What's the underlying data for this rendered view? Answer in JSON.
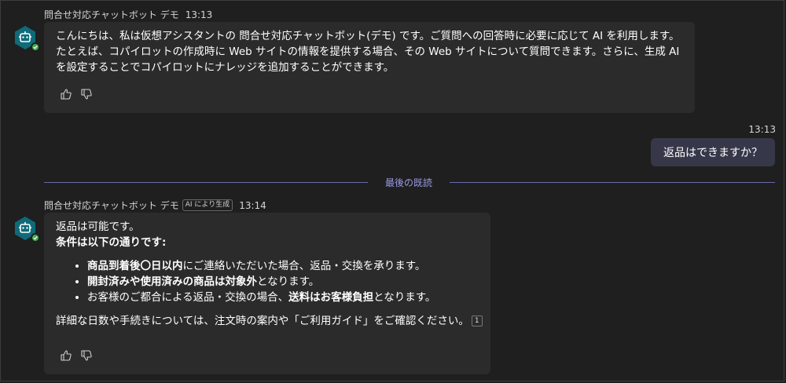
{
  "bot": {
    "name": "問合せ対応チャットボット デモ"
  },
  "msg1": {
    "time": "13:13",
    "text": "こんにちは、私は仮想アシスタントの 問合せ対応チャットボット(デモ) です。ご質問への回答時に必要に応じて AI を利用します。 たとえば、コパイロットの作成時に Web サイトの情報を提供する場合、その Web サイトについて質問できます。さらに、生成 AI を設定することでコパイロットにナレッジを追加することができます。"
  },
  "user_msg": {
    "time": "13:13",
    "text": "返品はできますか？"
  },
  "divider": {
    "label": "最後の既読"
  },
  "msg2": {
    "ai_badge": "AI により生成",
    "time": "13:14",
    "line1": "返品は可能です。",
    "line2": "条件は以下の通りです:",
    "bullets": [
      {
        "bold": "商品到着後〇日以内",
        "rest": "にご連絡いただいた場合、返品・交換を承ります。"
      },
      {
        "bold": "開封済みや使用済みの商品は対象外",
        "rest": "となります。"
      },
      {
        "pre": "お客様のご都合による返品・交換の場合、",
        "bold": "送料はお客様負担",
        "rest": "となります。"
      }
    ],
    "footer": "詳細な日数や手続きについては、注文時の案内や「ご利用ガイド」をご確認ください。",
    "citation": "1"
  },
  "icons": {
    "avatar": "bot-hexagon-icon",
    "like": "thumbs-up-icon",
    "dislike": "thumbs-down-icon",
    "status": "available-check-icon"
  },
  "colors": {
    "avatar": "#0f6b7a",
    "status": "#3fb04a",
    "divider": "#6a68a8",
    "user_bubble": "#36384a"
  }
}
